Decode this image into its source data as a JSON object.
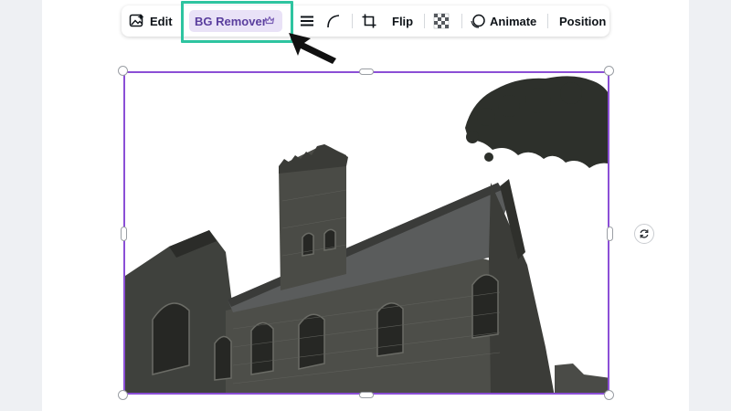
{
  "toolbar": {
    "edit_label": "Edit",
    "bg_remover_label": "BG Remover",
    "flip_label": "Flip",
    "animate_label": "Animate",
    "position_label": "Position"
  },
  "image": {
    "subject_icon": "church-photo"
  },
  "colors": {
    "highlight": "#2ec4a0",
    "selection": "#8b4fd6",
    "bg_remover_bg": "#e9e2f7",
    "bg_remover_text": "#5a3e9e"
  }
}
